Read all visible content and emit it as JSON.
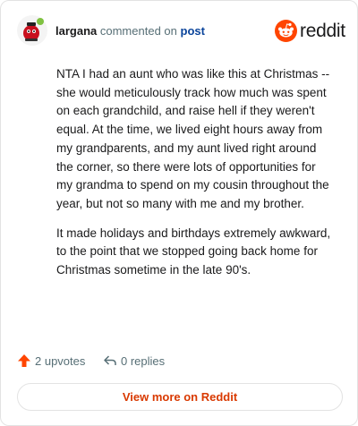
{
  "header": {
    "username": "largana",
    "action_text": "commented on",
    "post_link": "post",
    "logo_word": "reddit"
  },
  "comment": {
    "paragraphs": [
      "NTA I had an aunt who was like this at Christmas -- she would meticulously track how much was spent on each grandchild, and raise hell if they weren't equal. At the time, we lived eight hours away from my grandparents, and my aunt lived right around the corner, so there were lots of opportunities for my grandma to spend on my cousin throughout the year, but not so many with me and my brother.",
      "It made holidays and birthdays extremely awkward, to the point that we stopped going back home for Christmas sometime in the late 90's."
    ]
  },
  "actions": {
    "upvotes": "2 upvotes",
    "replies": "0 replies"
  },
  "footer": {
    "view_more": "View more on Reddit"
  },
  "colors": {
    "brand": "#ff4500",
    "link": "#0a449b",
    "view_more": "#d93900"
  },
  "icons": [
    "avatar",
    "reddit-logo-icon",
    "upvote-arrow-icon",
    "reply-icon"
  ]
}
